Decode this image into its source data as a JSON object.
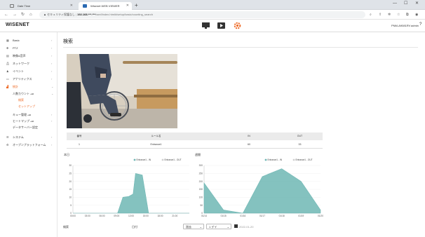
{
  "browser": {
    "tabs": [
      {
        "label": "Date Time",
        "active": false
      },
      {
        "label": "Wisenet WEB VIEWER",
        "active": true
      }
    ],
    "address": {
      "security_label": "セキュリティ保護なし",
      "host": "192.168.***.***",
      "path": "/wmf/index.html#/setup/basic/counting_search"
    }
  },
  "app": {
    "logo": "WISENET",
    "header_user": "PNM-A9081RV",
    "header_role": "admin",
    "accent": "#ee6b27",
    "chart_color": "#6fb7b4"
  },
  "sidebar": {
    "items": [
      {
        "label": "Basic",
        "icon": "grid-icon"
      },
      {
        "label": "PTZ",
        "icon": "move-icon"
      },
      {
        "label": "映像&音声",
        "icon": "video-icon"
      },
      {
        "label": "ネットワーク",
        "icon": "network-icon"
      },
      {
        "label": "イベント",
        "icon": "bell-icon"
      },
      {
        "label": "アナリティクス",
        "icon": "chart-icon"
      },
      {
        "label": "統計",
        "icon": "stats-icon"
      }
    ],
    "sub_items": [
      "人数カウント",
      "検索",
      "セットアップ",
      "キュー管理",
      "ヒートマップ",
      "データサーバー設定"
    ],
    "badge": "+AI",
    "bottom_items": [
      {
        "label": "システム",
        "icon": "list-icon"
      },
      {
        "label": "オープンプラットフォーム",
        "icon": "settings-icon"
      }
    ]
  },
  "page": {
    "title": "検索"
  },
  "table": {
    "headers": [
      "番号",
      "ルール名",
      "IN",
      "OUT"
    ],
    "rows": [
      [
        "1",
        "Entrance1",
        "60",
        "33"
      ]
    ]
  },
  "chart_data": [
    {
      "type": "area",
      "title": "本日",
      "legend": [
        "Entrance1 - IN",
        "Entrance1 - OUT"
      ],
      "legend_position": "top-right",
      "x": [
        "00:00",
        "03:00",
        "06:00",
        "09:00",
        "12:00",
        "15:00",
        "18:00",
        "21:00"
      ],
      "ylim": [
        0,
        30
      ],
      "yticks": [
        0,
        5,
        10,
        15,
        20,
        25,
        30
      ],
      "series": [
        {
          "name": "Entrance1 - IN",
          "points": [
            [
              0,
              0
            ],
            [
              9.2,
              0
            ],
            [
              10.3,
              10
            ],
            [
              11.5,
              10.5
            ],
            [
              12.4,
              12
            ],
            [
              12.9,
              25
            ],
            [
              14.3,
              24
            ],
            [
              15.6,
              0
            ],
            [
              24,
              0
            ]
          ]
        },
        {
          "name": "Entrance1 - OUT",
          "points": []
        }
      ]
    },
    {
      "type": "area",
      "title": "週間",
      "legend": [
        "Entrance1 - IN",
        "Entrance1 - OUT"
      ],
      "legend_position": "top-right",
      "x": [
        "01/14",
        "01/15",
        "01/16",
        "01/17",
        "01/18",
        "01/19",
        "01/20"
      ],
      "ylim": [
        0,
        300
      ],
      "yticks": [
        0,
        50,
        100,
        150,
        200,
        250,
        300
      ],
      "series": [
        {
          "name": "Entrance1 - IN",
          "values": [
            190,
            20,
            0,
            230,
            280,
            200,
            20
          ]
        },
        {
          "name": "Entrance1 - OUT",
          "values": []
        }
      ]
    }
  ],
  "bottom": {
    "result_label": "検索",
    "date_label": "日付",
    "period_value": "過去",
    "range_value": "1 デイ",
    "date_value": "2022-01-20"
  }
}
